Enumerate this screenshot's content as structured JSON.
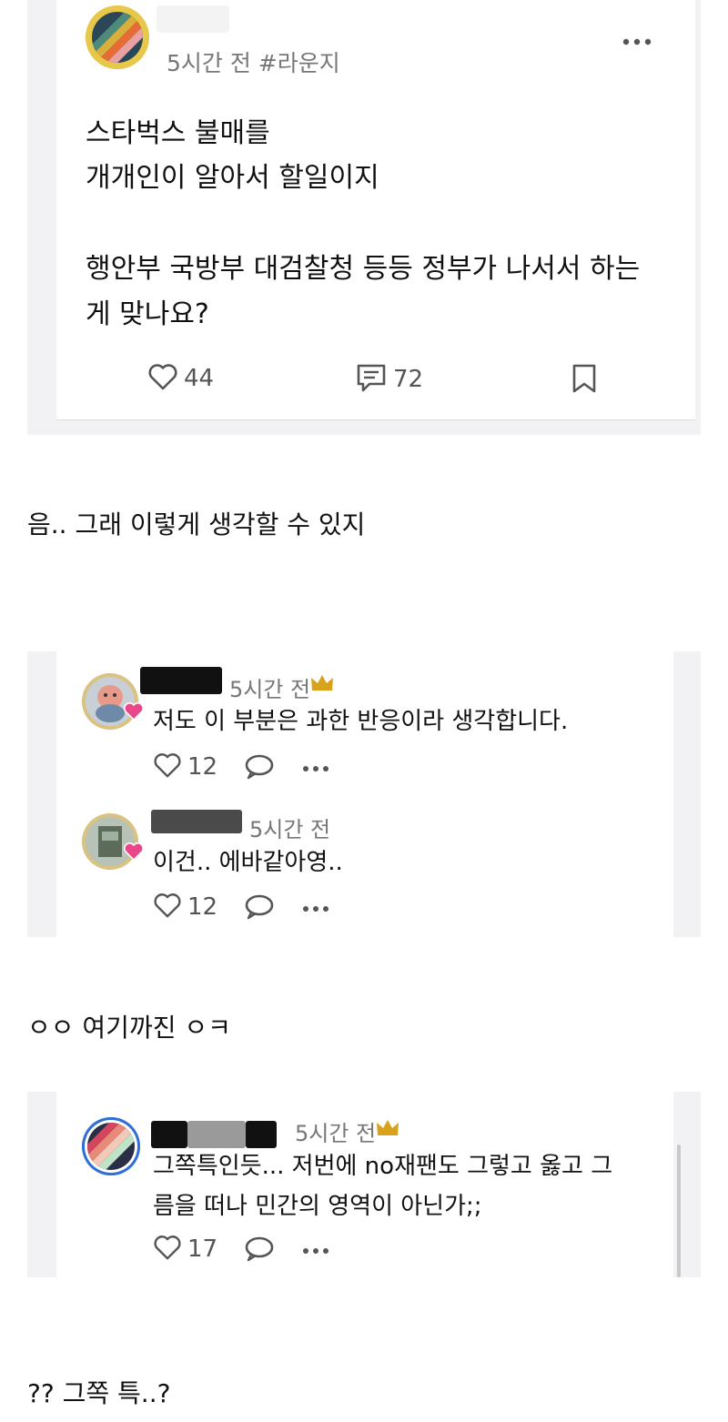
{
  "post": {
    "time_board": "5시간 전 #라운지",
    "body_lines": [
      "스타벅스 불매를",
      "개개인이 알아서 할일이지",
      "",
      "행안부 국방부 대검찰청 등등 정부가 나서서 하는",
      "게 맞나요?"
    ],
    "likes": "44",
    "comments": "72",
    "icons": {
      "like": "heart-icon",
      "comment": "comment-icon",
      "bookmark": "bookmark-icon",
      "more": "more-dots-icon"
    }
  },
  "caption1": "음.. 그래 이렇게 생각할 수 있지",
  "comments1": [
    {
      "username": "",
      "time": "5시간 전",
      "text": "저도 이 부분은 과한 반응이라 생각합니다.",
      "likes": "12"
    },
    {
      "username": "",
      "time": "5시간 전",
      "text": "이건.. 에바같아영..",
      "likes": "12"
    }
  ],
  "caption2": "ㅇㅇ 여기까진 ㅇㅋ",
  "comments2": [
    {
      "username": "",
      "time": "5시간 전",
      "text_lines": [
        "그쪽특인듯... 저번에 no재팬도 그렇고 옳고 그",
        "름을 떠나 민간의 영역이 아닌가;;"
      ],
      "likes": "17"
    }
  ],
  "caption3": "?? 그쪽 특..?",
  "colors": {
    "crown": "#d9a21b",
    "pink_heart": "#e8488a",
    "avatar_ring": "#e7c84a",
    "blue_ring": "#2f6fd6"
  }
}
